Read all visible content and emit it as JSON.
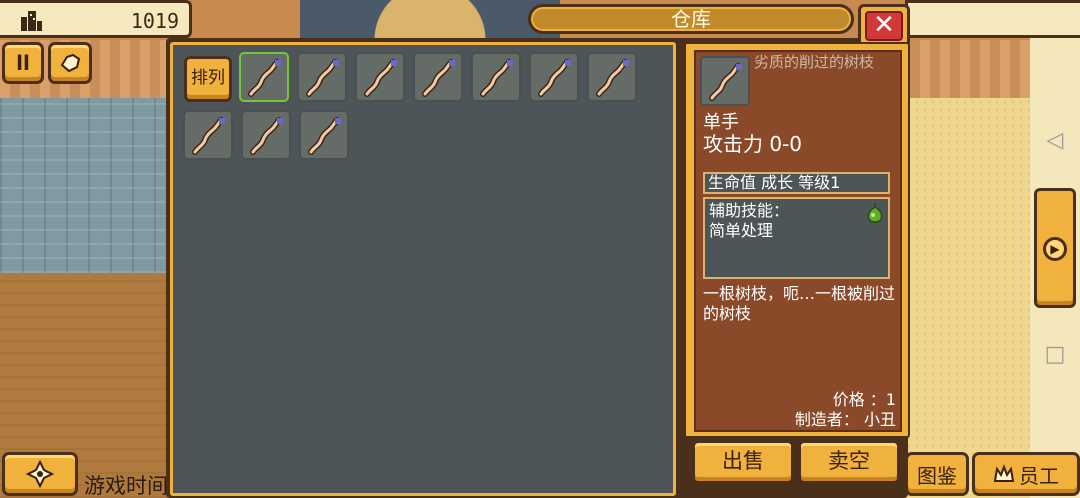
{
  "hud": {
    "resource_value": "1019",
    "game_time_label": "游戏时间",
    "pause_label": "ll",
    "codex_label": "图鉴",
    "staff_label": "员工"
  },
  "warehouse": {
    "title": "仓库",
    "close_label": "✕",
    "sort_label": "排列",
    "slots": [
      {
        "item": "stick-icon",
        "selected": true
      },
      {
        "item": "stick-icon"
      },
      {
        "item": "stick-icon"
      },
      {
        "item": "stick-icon"
      },
      {
        "item": "stick-icon"
      },
      {
        "item": "stick-icon"
      },
      {
        "item": "stick-icon"
      },
      {
        "item": "stick-icon"
      },
      {
        "item": "stick-icon"
      },
      {
        "item": "stick-icon"
      }
    ]
  },
  "detail": {
    "item_name": "劣质的削过的树枝",
    "hand": "单手",
    "attack": "攻击力 0-0",
    "tags": "生命值 成长 等级1",
    "skill_title": "辅助技能：",
    "skill_name": "简单处理",
    "description": "一根树枝，呃…一根被削过的树枝",
    "price": "价格 ：1",
    "maker": "制造者： 小丑",
    "sell_label": "出售",
    "sell_all_label": "卖空"
  },
  "colors": {
    "accent_gold": "#f0b23c",
    "panel_gray": "#4e5558",
    "detail_brown": "#8a4a2a",
    "selected_green": "#7ac23a",
    "close_red": "#d23a3a"
  }
}
